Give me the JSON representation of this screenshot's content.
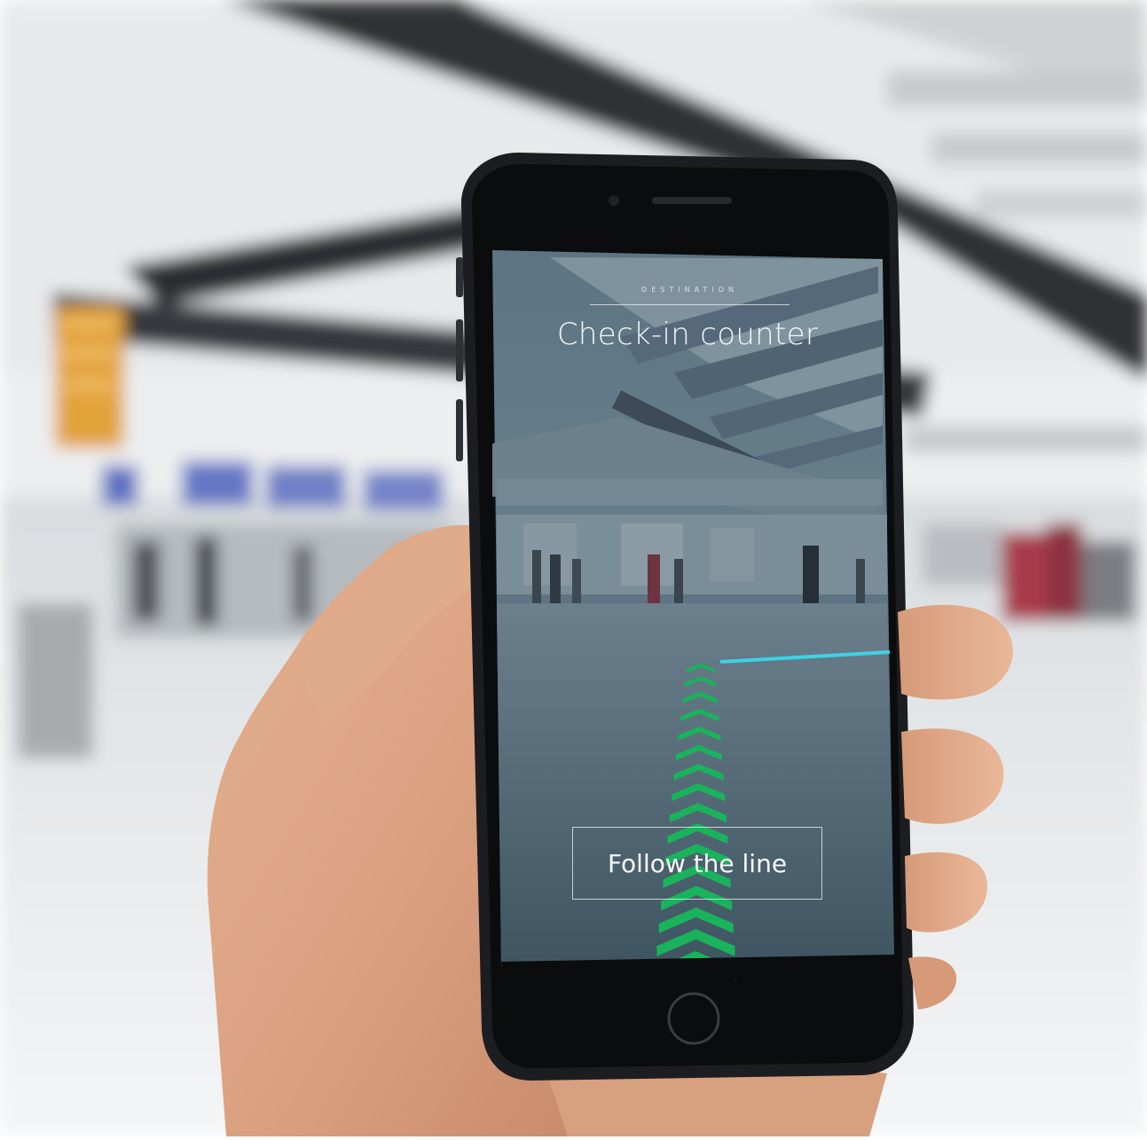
{
  "screen": {
    "destination_label": "DESTINATION",
    "destination_name": "Check-in counter",
    "instruction_button": "Follow the line"
  },
  "colors": {
    "guide_arrows": "#19b35c",
    "route_line": "#3fd1e6",
    "screen_tint": "#4c6473"
  }
}
